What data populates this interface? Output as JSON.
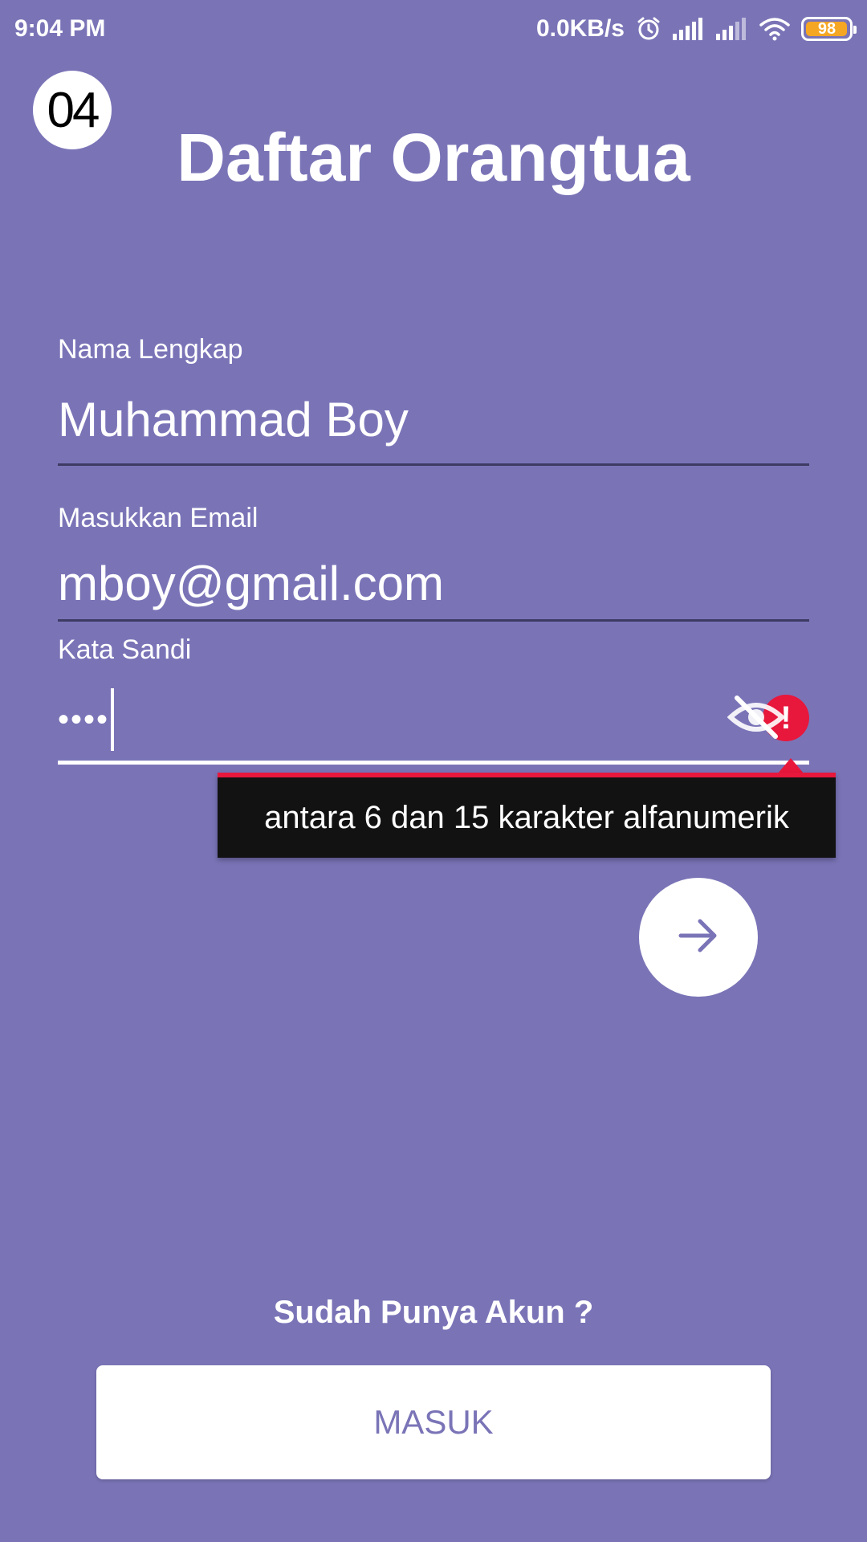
{
  "status_bar": {
    "time": "9:04 PM",
    "network_speed": "0.0KB/s",
    "battery_level": "98",
    "battery_fraction": 0.98,
    "icons": [
      "alarm-icon",
      "signal-icon",
      "signal-icon",
      "wifi-icon",
      "battery-icon"
    ]
  },
  "header": {
    "step": "04",
    "title": "Daftar Orangtua"
  },
  "form": {
    "name": {
      "label": "Nama Lengkap",
      "value": "Muhammad Boy"
    },
    "email": {
      "label": "Masukkan Email",
      "value": "mboy@gmail.com"
    },
    "password": {
      "label": "Kata Sandi",
      "value_masked": "••••",
      "toggle_icon": "eye-off-icon",
      "error_icon": "error-icon"
    },
    "error_message": "antara 6 dan 15 karakter alfanumerik",
    "next_icon": "arrow-right-icon"
  },
  "footer": {
    "prompt": "Sudah Punya Akun ?",
    "login_label": "MASUK"
  },
  "colors": {
    "background": "#7A74B7",
    "accent": "#7A74B7",
    "error": "#E8173C",
    "tooltip": "#121212",
    "battery": "#F5A623"
  }
}
